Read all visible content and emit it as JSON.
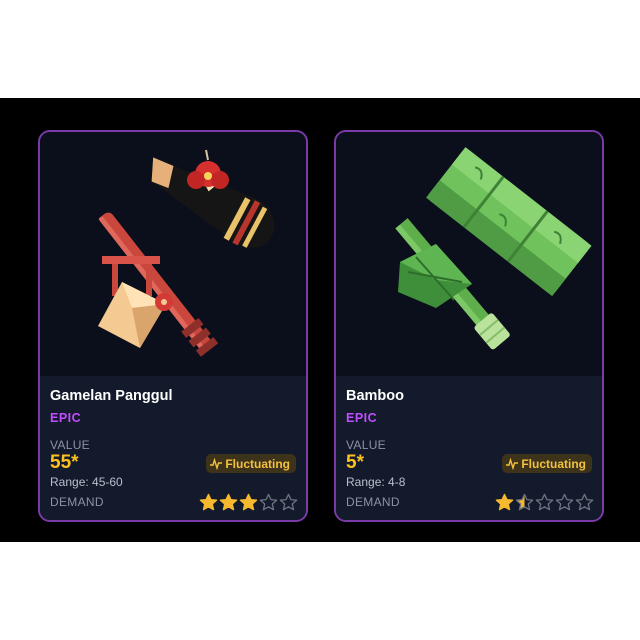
{
  "items": [
    {
      "name": "Gamelan Panggul",
      "rarity": "EPIC",
      "value_label": "VALUE",
      "value": "55",
      "value_marker": "*",
      "range": "Range: 45-60",
      "trend": "Fluctuating",
      "demand_label": "DEMAND",
      "demand_rating": 3,
      "demand_max": 5,
      "icon": "gamelan-mallet-icon"
    },
    {
      "name": "Bamboo",
      "rarity": "EPIC",
      "value_label": "VALUE",
      "value": "5",
      "value_marker": "*",
      "range": "Range: 4-8",
      "trend": "Fluctuating",
      "demand_label": "DEMAND",
      "demand_rating": 1.5,
      "demand_max": 5,
      "icon": "bamboo-hammer-icon"
    }
  ],
  "colors": {
    "card_border": "#7a3aa8",
    "rarity_epic": "#c04dff",
    "value_gold": "#ffc11f",
    "trend_text": "#f3c13d",
    "star_filled": "#f5b82e",
    "star_empty": "#6b7280"
  }
}
